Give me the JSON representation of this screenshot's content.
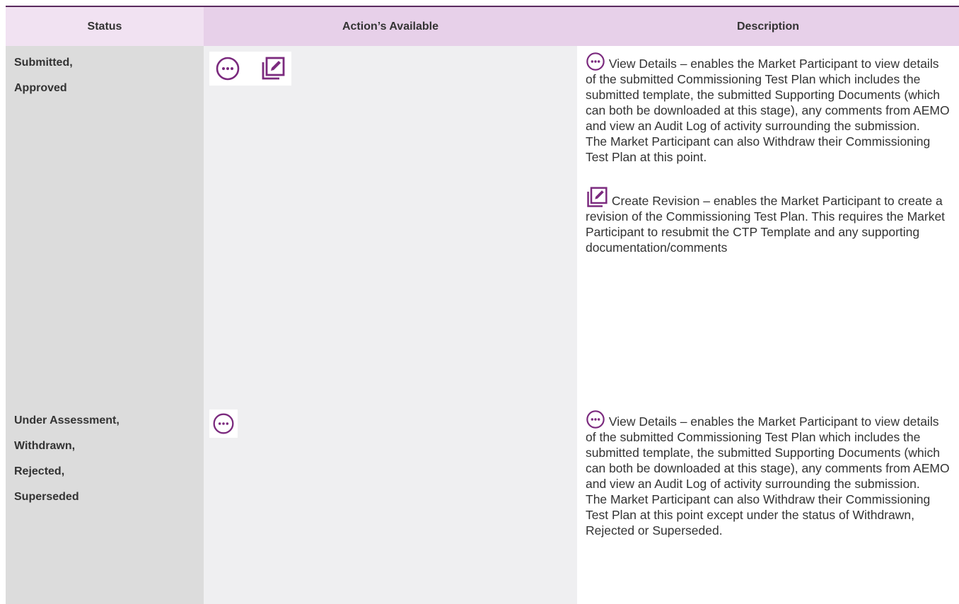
{
  "header": {
    "status": "Status",
    "actions": "Action’s Available",
    "description": "Description"
  },
  "rows": [
    {
      "statuses": [
        "Submitted,",
        "Approved"
      ],
      "action_icons": [
        "view-details-icon",
        "create-revision-icon"
      ],
      "view_details": {
        "label": "View Details – enables the Market Participant to view details of the submitted Commissioning Test Plan which includes the submitted template, the submitted Supporting Documents (which can both be downloaded at this stage), any comments from AEMO and view an Audit Log of activity surrounding the submission.",
        "note": "The Market Participant can also Withdraw their Commissioning Test Plan at this point."
      },
      "create_revision": {
        "label": "Create Revision – enables the Market Participant to create a revision of the Commissioning Test Plan. This requires the Market Participant to resubmit the CTP Template and any supporting documentation/comments"
      }
    },
    {
      "statuses": [
        "Under Assessment,",
        "Withdrawn,",
        "Rejected,",
        "Superseded"
      ],
      "action_icons": [
        "view-details-icon"
      ],
      "view_details": {
        "label": "View Details – enables the Market Participant to view details of the submitted Commissioning Test Plan which includes the submitted template, the submitted Supporting Documents (which can both be downloaded at this stage), any comments from AEMO and view an Audit Log of activity surrounding the submission.",
        "note": "The Market Participant can also Withdraw their Commissioning Test Plan at this point except under the status of Withdrawn, Rejected or Superseded."
      }
    }
  ],
  "colors": {
    "accent": "#7b2a7e",
    "header_bg": "#e7d0e9",
    "status_bg": "#dcdcdc",
    "actions_bg": "#efeff1"
  }
}
